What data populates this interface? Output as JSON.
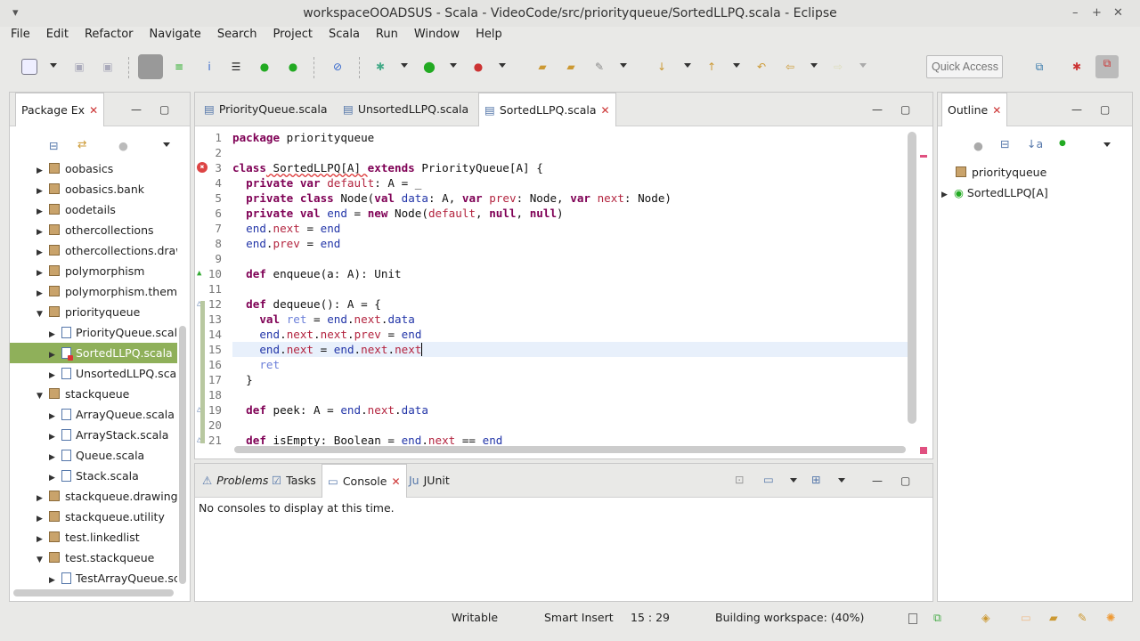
{
  "window": {
    "title": "workspaceOOADSUS - Scala - VideoCode/src/priorityqueue/SortedLLPQ.scala - Eclipse"
  },
  "menu": [
    "File",
    "Edit",
    "Refactor",
    "Navigate",
    "Search",
    "Project",
    "Scala",
    "Run",
    "Window",
    "Help"
  ],
  "toolbar": {
    "quick_access_placeholder": "Quick Access"
  },
  "package_explorer": {
    "title": "Package Ex",
    "items": [
      {
        "label": "oobasics",
        "type": "package",
        "expanded": false,
        "indent": 0
      },
      {
        "label": "oobasics.bank",
        "type": "package",
        "expanded": false,
        "indent": 0
      },
      {
        "label": "oodetails",
        "type": "package",
        "expanded": false,
        "indent": 0
      },
      {
        "label": "othercollections",
        "type": "package",
        "expanded": false,
        "indent": 0
      },
      {
        "label": "othercollections.drawi",
        "type": "package",
        "expanded": false,
        "indent": 0
      },
      {
        "label": "polymorphism",
        "type": "package",
        "expanded": false,
        "indent": 0
      },
      {
        "label": "polymorphism.themep",
        "type": "package",
        "expanded": false,
        "indent": 0
      },
      {
        "label": "priorityqueue",
        "type": "package",
        "expanded": true,
        "indent": 0
      },
      {
        "label": "PriorityQueue.scala",
        "type": "file",
        "expanded": false,
        "indent": 1
      },
      {
        "label": "SortedLLPQ.scala",
        "type": "file",
        "expanded": false,
        "indent": 1,
        "selected": true,
        "error": true
      },
      {
        "label": "UnsortedLLPQ.scala",
        "type": "file",
        "expanded": false,
        "indent": 1
      },
      {
        "label": "stackqueue",
        "type": "package",
        "expanded": true,
        "indent": 0
      },
      {
        "label": "ArrayQueue.scala",
        "type": "file",
        "expanded": false,
        "indent": 1
      },
      {
        "label": "ArrayStack.scala",
        "type": "file",
        "expanded": false,
        "indent": 1
      },
      {
        "label": "Queue.scala",
        "type": "file",
        "expanded": false,
        "indent": 1
      },
      {
        "label": "Stack.scala",
        "type": "file",
        "expanded": false,
        "indent": 1
      },
      {
        "label": "stackqueue.drawing",
        "type": "package",
        "expanded": false,
        "indent": 0
      },
      {
        "label": "stackqueue.utility",
        "type": "package",
        "expanded": false,
        "indent": 0
      },
      {
        "label": "test.linkedlist",
        "type": "package",
        "expanded": false,
        "indent": 0
      },
      {
        "label": "test.stackqueue",
        "type": "package",
        "expanded": true,
        "indent": 0
      },
      {
        "label": "TestArrayQueue.sca",
        "type": "file",
        "expanded": false,
        "indent": 1
      }
    ]
  },
  "editor": {
    "tabs": [
      {
        "label": "PriorityQueue.scala"
      },
      {
        "label": "UnsortedLLPQ.scala"
      },
      {
        "label": "SortedLLPQ.scala",
        "active": true
      }
    ],
    "current_line": 15,
    "lines": [
      [
        [
          "package",
          "kw"
        ],
        [
          " priorityqueue",
          "pl"
        ]
      ],
      [],
      [
        [
          "class",
          "kw"
        ],
        [
          " SortedLLPQ[A] ",
          "pl"
        ],
        [
          "extends",
          "kw"
        ],
        [
          " PriorityQueue[A] {",
          "pl"
        ]
      ],
      [
        [
          "  "
        ],
        [
          "private",
          "kw"
        ],
        [
          " "
        ],
        [
          "var",
          "kw"
        ],
        [
          " "
        ],
        [
          "default",
          "fld"
        ],
        [
          ": A = _",
          "pl"
        ]
      ],
      [
        [
          "  "
        ],
        [
          "private",
          "kw"
        ],
        [
          " "
        ],
        [
          "class",
          "kw"
        ],
        [
          " Node(",
          "pl"
        ],
        [
          "val",
          "kw"
        ],
        [
          " "
        ],
        [
          "data",
          "vr"
        ],
        [
          ": A, ",
          "pl"
        ],
        [
          "var",
          "kw"
        ],
        [
          " "
        ],
        [
          "prev",
          "fld"
        ],
        [
          ": Node, ",
          "pl"
        ],
        [
          "var",
          "kw"
        ],
        [
          " "
        ],
        [
          "next",
          "fld"
        ],
        [
          ": Node)",
          "pl"
        ]
      ],
      [
        [
          "  "
        ],
        [
          "private",
          "kw"
        ],
        [
          " "
        ],
        [
          "val",
          "kw"
        ],
        [
          " "
        ],
        [
          "end",
          "vr"
        ],
        [
          " = ",
          "pl"
        ],
        [
          "new",
          "kw"
        ],
        [
          " Node(",
          "pl"
        ],
        [
          "default",
          "fld"
        ],
        [
          ", ",
          "pl"
        ],
        [
          "null",
          "kw"
        ],
        [
          ", ",
          "pl"
        ],
        [
          "null",
          "kw"
        ],
        [
          ")",
          "pl"
        ]
      ],
      [
        [
          "  "
        ],
        [
          "end",
          "vr"
        ],
        [
          ".",
          "pl"
        ],
        [
          "next",
          "fld"
        ],
        [
          " = ",
          "pl"
        ],
        [
          "end",
          "vr"
        ]
      ],
      [
        [
          "  "
        ],
        [
          "end",
          "vr"
        ],
        [
          ".",
          "pl"
        ],
        [
          "prev",
          "fld"
        ],
        [
          " = ",
          "pl"
        ],
        [
          "end",
          "vr"
        ]
      ],
      [],
      [
        [
          "  "
        ],
        [
          "def",
          "kw"
        ],
        [
          " enqueue(a: A): Unit",
          "pl"
        ]
      ],
      [],
      [
        [
          "  "
        ],
        [
          "def",
          "kw"
        ],
        [
          " dequeue(): A = {",
          "pl"
        ]
      ],
      [
        [
          "    "
        ],
        [
          "val",
          "kw"
        ],
        [
          " "
        ],
        [
          "ret",
          "lv"
        ],
        [
          " = ",
          "pl"
        ],
        [
          "end",
          "vr"
        ],
        [
          ".",
          "pl"
        ],
        [
          "next",
          "fld"
        ],
        [
          ".",
          "pl"
        ],
        [
          "data",
          "vr"
        ]
      ],
      [
        [
          "    "
        ],
        [
          "end",
          "vr"
        ],
        [
          ".",
          "pl"
        ],
        [
          "next",
          "fld"
        ],
        [
          ".",
          "pl"
        ],
        [
          "next",
          "fld"
        ],
        [
          ".",
          "pl"
        ],
        [
          "prev",
          "fld"
        ],
        [
          " = ",
          "pl"
        ],
        [
          "end",
          "vr"
        ]
      ],
      [
        [
          "    "
        ],
        [
          "end",
          "vr"
        ],
        [
          ".",
          "pl"
        ],
        [
          "next",
          "fld"
        ],
        [
          " = ",
          "pl"
        ],
        [
          "end",
          "vr"
        ],
        [
          ".",
          "pl"
        ],
        [
          "next",
          "fld"
        ],
        [
          ".",
          "pl"
        ],
        [
          "next",
          "fld"
        ]
      ],
      [
        [
          "    "
        ],
        [
          "ret",
          "lv"
        ]
      ],
      [
        [
          "  }",
          "pl"
        ]
      ],
      [],
      [
        [
          "  "
        ],
        [
          "def",
          "kw"
        ],
        [
          " peek: A = ",
          "pl"
        ],
        [
          "end",
          "vr"
        ],
        [
          ".",
          "pl"
        ],
        [
          "next",
          "fld"
        ],
        [
          ".",
          "pl"
        ],
        [
          "data",
          "vr"
        ]
      ],
      [],
      [
        [
          "  "
        ],
        [
          "def",
          "kw"
        ],
        [
          " isEmpty: Boolean = ",
          "pl"
        ],
        [
          "end",
          "vr"
        ],
        [
          ".",
          "pl"
        ],
        [
          "next",
          "fld"
        ],
        [
          " == ",
          "pl"
        ],
        [
          "end",
          "vr"
        ]
      ]
    ]
  },
  "outline": {
    "title": "Outline",
    "items": [
      {
        "label": "priorityqueue"
      },
      {
        "label": "SortedLLPQ[A]"
      }
    ]
  },
  "bottom": {
    "tabs": [
      {
        "label": "Problems"
      },
      {
        "label": "Tasks"
      },
      {
        "label": "Console",
        "active": true
      },
      {
        "label": "JUnit"
      }
    ],
    "message": "No consoles to display at this time."
  },
  "status": {
    "writable": "Writable",
    "insert_mode": "Smart Insert",
    "position": "15 : 29",
    "progress_text": "Building workspace: (40%)",
    "progress_percent": 40
  }
}
